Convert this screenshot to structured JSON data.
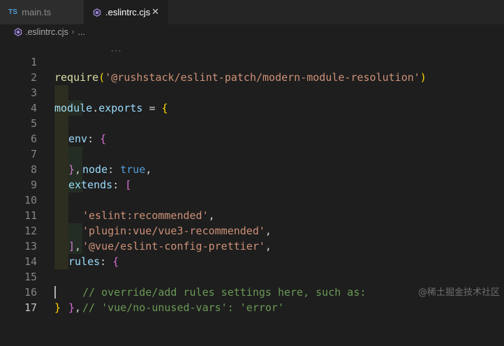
{
  "tabs": [
    {
      "icon": "ts-icon",
      "badge": "TS",
      "label": "main.ts",
      "active": false
    },
    {
      "icon": "eslint-icon",
      "label": ".eslintrc.cjs",
      "active": true,
      "close": "✕"
    }
  ],
  "breadcrumb": {
    "file": ".eslintrc.cjs",
    "separator": "›",
    "more": "..."
  },
  "editor": {
    "line_numbers": [
      "1",
      "2",
      "3",
      "4",
      "5",
      "6",
      "7",
      "8",
      "9",
      "10",
      "11",
      "12",
      "13",
      "14",
      "15",
      "16",
      "17"
    ],
    "current_line": "17",
    "code": {
      "l1_fn": "require",
      "l1_open": "(",
      "l1_str": "'@rushstack/eslint-patch/modern-module-resolution'",
      "l1_close": ")",
      "l3_module": "module",
      "l3_dot": ".",
      "l3_exports": "exports",
      "l3_eq": " = ",
      "l3_brace": "{",
      "l4_key": "env",
      "l4_colon": ": ",
      "l4_brace": "{",
      "l5_key": "node",
      "l5_colon": ": ",
      "l5_val": "true",
      "l5_comma": ",",
      "l6_brace": "}",
      "l6_comma": ",",
      "l7_key": "extends",
      "l7_colon": ": ",
      "l7_bracket": "[",
      "l8_str": "'eslint:recommended'",
      "l8_comma": ",",
      "l9_str": "'plugin:vue/vue3-recommended'",
      "l9_comma": ",",
      "l10_str": "'@vue/eslint-config-prettier'",
      "l10_comma": ",",
      "l11_bracket": "]",
      "l11_comma": ",",
      "l12_key": "rules",
      "l12_colon": ": ",
      "l12_brace": "{",
      "l13_comment": "// override/add rules settings here, such as:",
      "l14_comment": "// 'vue/no-unused-vars': 'error'",
      "l15_brace": "}",
      "l15_comma": ",",
      "l16_brace": "}"
    }
  },
  "watermark": "@稀土掘金技术社区",
  "colors": {
    "background": "#1e1e1e",
    "string": "#ce9178",
    "keyword_blue": "#569cd6",
    "property": "#9cdcfe",
    "function": "#dcdcaa",
    "comment": "#6a9955",
    "bracket_level1": "#ffd700",
    "bracket_level2": "#da70d6",
    "bracket_level3": "#179fff"
  }
}
